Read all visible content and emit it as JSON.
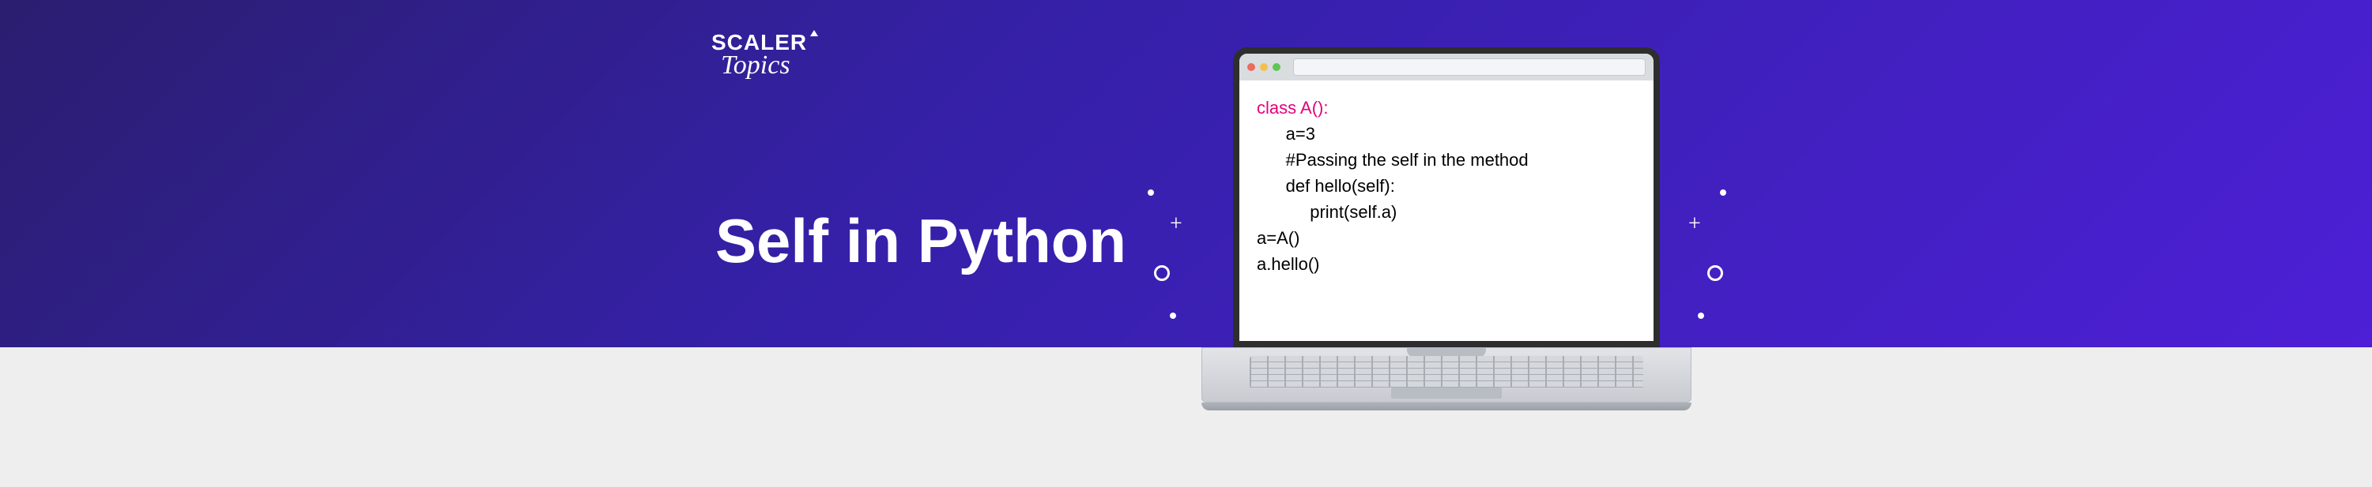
{
  "logo": {
    "brand": "SCALER",
    "subbrand": "Topics"
  },
  "title": "Self in Python",
  "code": {
    "line1": "class A():",
    "line2": "      a=3",
    "line3": "      #Passing the self in the method",
    "line4": "      def hello(self):",
    "line5": "           print(self.a)",
    "line6": "a=A()",
    "line7": "a.hello()"
  }
}
